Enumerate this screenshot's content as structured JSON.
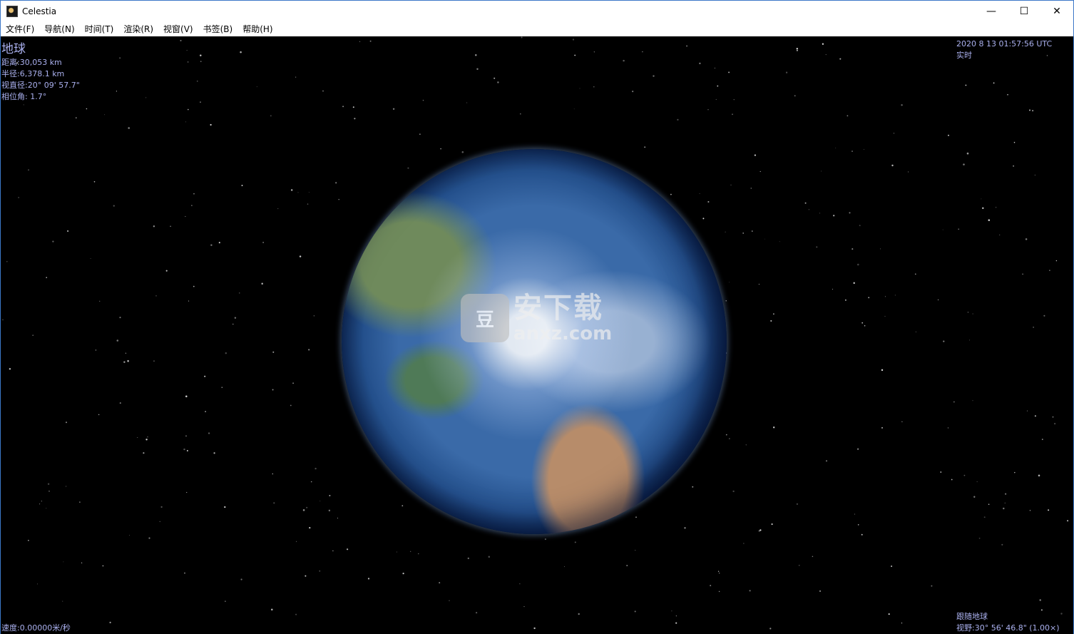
{
  "window": {
    "title": "Celestia",
    "controls": {
      "minimize": "—",
      "maximize": "☐",
      "close": "✕"
    }
  },
  "menu": [
    "文件(F)",
    "导航(N)",
    "时间(T)",
    "渲染(R)",
    "视窗(V)",
    "书签(B)",
    "帮助(H)"
  ],
  "info": {
    "name": "地球",
    "distance": "距离:30,053 km",
    "radius": "半径:6,378.1 km",
    "apparent_diameter": "视直径:20° 09' 57.7\"",
    "phase_angle": "相位角: 1.7°"
  },
  "time": {
    "datetime": "2020 8 13 01:57:56 UTC",
    "mode": "实时"
  },
  "status": {
    "speed": "速度:0.00000米/秒",
    "follow": "跟随地球",
    "fov": "视野:30° 56' 46.8\" (1.00×)"
  },
  "watermark": {
    "badge": "豆",
    "cn": "安下载",
    "en": "anxz.com"
  }
}
